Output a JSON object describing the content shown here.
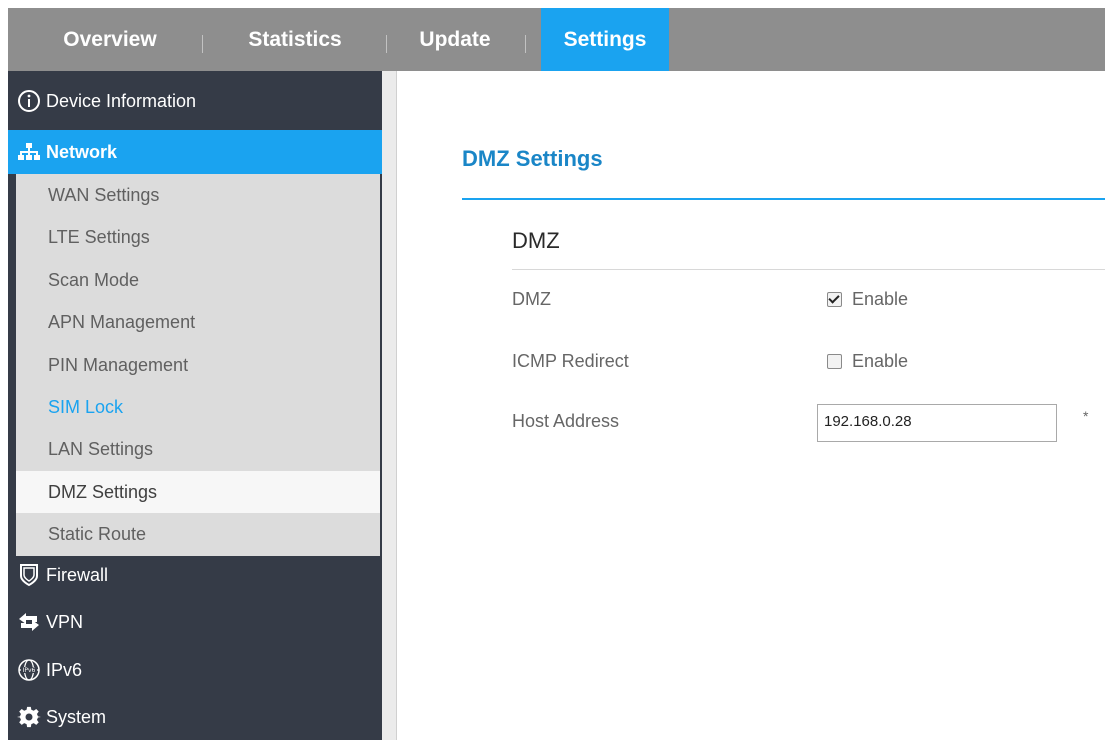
{
  "tabs": [
    {
      "label": "Overview"
    },
    {
      "label": "Statistics"
    },
    {
      "label": "Update"
    },
    {
      "label": "Settings"
    }
  ],
  "sidebar": {
    "device_info": "Device Information",
    "network": "Network",
    "network_sub": [
      "WAN Settings",
      "LTE Settings",
      "Scan Mode",
      "APN Management",
      "PIN Management",
      "SIM Lock",
      "LAN Settings",
      "DMZ Settings",
      "Static Route"
    ],
    "firewall": "Firewall",
    "vpn": "VPN",
    "ipv6": "IPv6",
    "system": "System"
  },
  "main": {
    "page_title": "DMZ Settings",
    "section_title": "DMZ",
    "dmz_label": "DMZ",
    "dmz_enable_label": "Enable",
    "dmz_enabled": true,
    "icmp_label": "ICMP Redirect",
    "icmp_enable_label": "Enable",
    "icmp_enabled": false,
    "host_label": "Host Address",
    "host_value": "192.168.0.28",
    "required_mark": "*"
  },
  "colors": {
    "accent": "#1aa3f0",
    "topbar": "#8e8e8e",
    "sidebar": "#353b47",
    "submenu": "#dcdcdc"
  }
}
